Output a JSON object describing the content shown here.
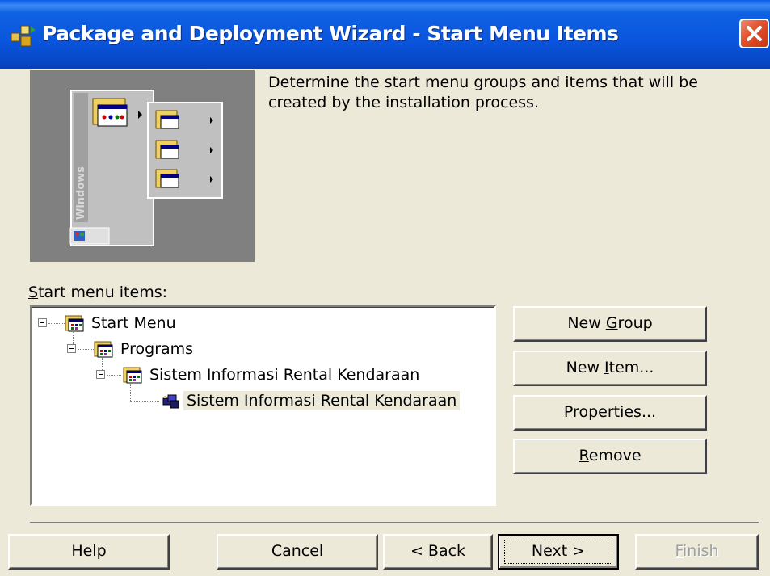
{
  "window": {
    "title": "Package and Deployment Wizard - Start Menu Items",
    "title_icon": "package-deployment-icon",
    "close_icon": "close-icon"
  },
  "illustration": {
    "vertical_text": "Windows"
  },
  "description": "Determine the start menu groups and items that will be created by the installation process.",
  "tree_label": {
    "accel": "S",
    "rest": "tart menu items:"
  },
  "tree": {
    "nodes": [
      {
        "label": "Start Menu",
        "icon": "folder-icon",
        "expanded": true
      },
      {
        "label": "Programs",
        "icon": "folder-icon",
        "expanded": true
      },
      {
        "label": "Sistem Informasi Rental Kendaraan",
        "icon": "folder-icon",
        "expanded": true
      },
      {
        "label": "Sistem Informasi Rental Kendaraan",
        "icon": "app-shortcut-icon",
        "selected": true
      }
    ]
  },
  "side_buttons": {
    "new_group": {
      "pre": "New ",
      "accel": "G",
      "post": "roup"
    },
    "new_item": {
      "pre": "New ",
      "accel": "I",
      "post": "tem..."
    },
    "properties": {
      "pre": "",
      "accel": "P",
      "post": "roperties..."
    },
    "remove": {
      "pre": "",
      "accel": "R",
      "post": "emove"
    }
  },
  "footer_buttons": {
    "help": "Help",
    "cancel": "Cancel",
    "back": {
      "pre": "< ",
      "accel": "B",
      "post": "ack"
    },
    "next": {
      "pre": "",
      "accel": "N",
      "post": "ext >"
    },
    "finish": {
      "pre": "",
      "accel": "F",
      "post": "inish"
    }
  },
  "colors": {
    "titlebar": "#0a55dd",
    "face": "#ece9d8",
    "close": "#e2502c"
  }
}
